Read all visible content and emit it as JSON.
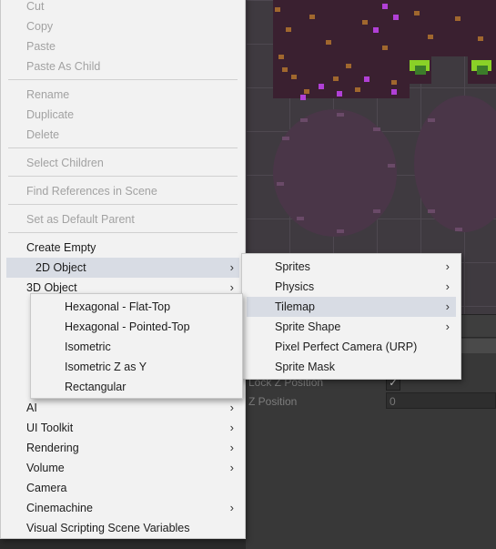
{
  "context_menu": {
    "items": [
      {
        "label": "Cut",
        "enabled": false
      },
      {
        "label": "Copy",
        "enabled": false
      },
      {
        "label": "Paste",
        "enabled": false
      },
      {
        "label": "Paste As Child",
        "enabled": false
      },
      {
        "label": "Rename",
        "enabled": false
      },
      {
        "label": "Duplicate",
        "enabled": false
      },
      {
        "label": "Delete",
        "enabled": false
      },
      {
        "label": "Select Children",
        "enabled": false
      },
      {
        "label": "Find References in Scene",
        "enabled": false
      },
      {
        "label": "Set as Default Parent",
        "enabled": false
      },
      {
        "label": "Create Empty",
        "enabled": true
      },
      {
        "label": "2D Object",
        "enabled": true,
        "submenu": true,
        "highlighted": true
      },
      {
        "label": "3D Object",
        "enabled": true,
        "submenu": true
      },
      {
        "label": "AI",
        "enabled": true,
        "submenu": true
      },
      {
        "label": "UI Toolkit",
        "enabled": true,
        "submenu": true
      },
      {
        "label": "Rendering",
        "enabled": true,
        "submenu": true
      },
      {
        "label": "Volume",
        "enabled": true,
        "submenu": true
      },
      {
        "label": "Camera",
        "enabled": true
      },
      {
        "label": "Cinemachine",
        "enabled": true,
        "submenu": true
      },
      {
        "label": "Visual Scripting Scene Variables",
        "enabled": true
      }
    ]
  },
  "submenu_2d_object": {
    "items": [
      {
        "label": "Sprites",
        "submenu": true
      },
      {
        "label": "Physics",
        "submenu": true
      },
      {
        "label": "Tilemap",
        "submenu": true,
        "highlighted": true
      },
      {
        "label": "Sprite Shape",
        "submenu": true
      },
      {
        "label": "Pixel Perfect Camera (URP)"
      },
      {
        "label": "Sprite Mask"
      }
    ]
  },
  "submenu_tilemap": {
    "items": [
      {
        "label": "Hexagonal - Flat-Top"
      },
      {
        "label": "Hexagonal - Pointed-Top"
      },
      {
        "label": "Isometric"
      },
      {
        "label": "Isometric Z as Y"
      },
      {
        "label": "Rectangular"
      }
    ]
  },
  "inspector": {
    "lock_z_label": "Lock Z Position",
    "lock_z_checked": "✓",
    "z_position_label": "Z Position",
    "z_position_value": "0"
  },
  "icons": {
    "submenu_arrow": "chevron-right-icon",
    "check": "check-icon"
  },
  "colors": {
    "menu_bg": "#f2f2f2",
    "highlight": "#d8dce4",
    "disabled_text": "#a2a2a2"
  }
}
